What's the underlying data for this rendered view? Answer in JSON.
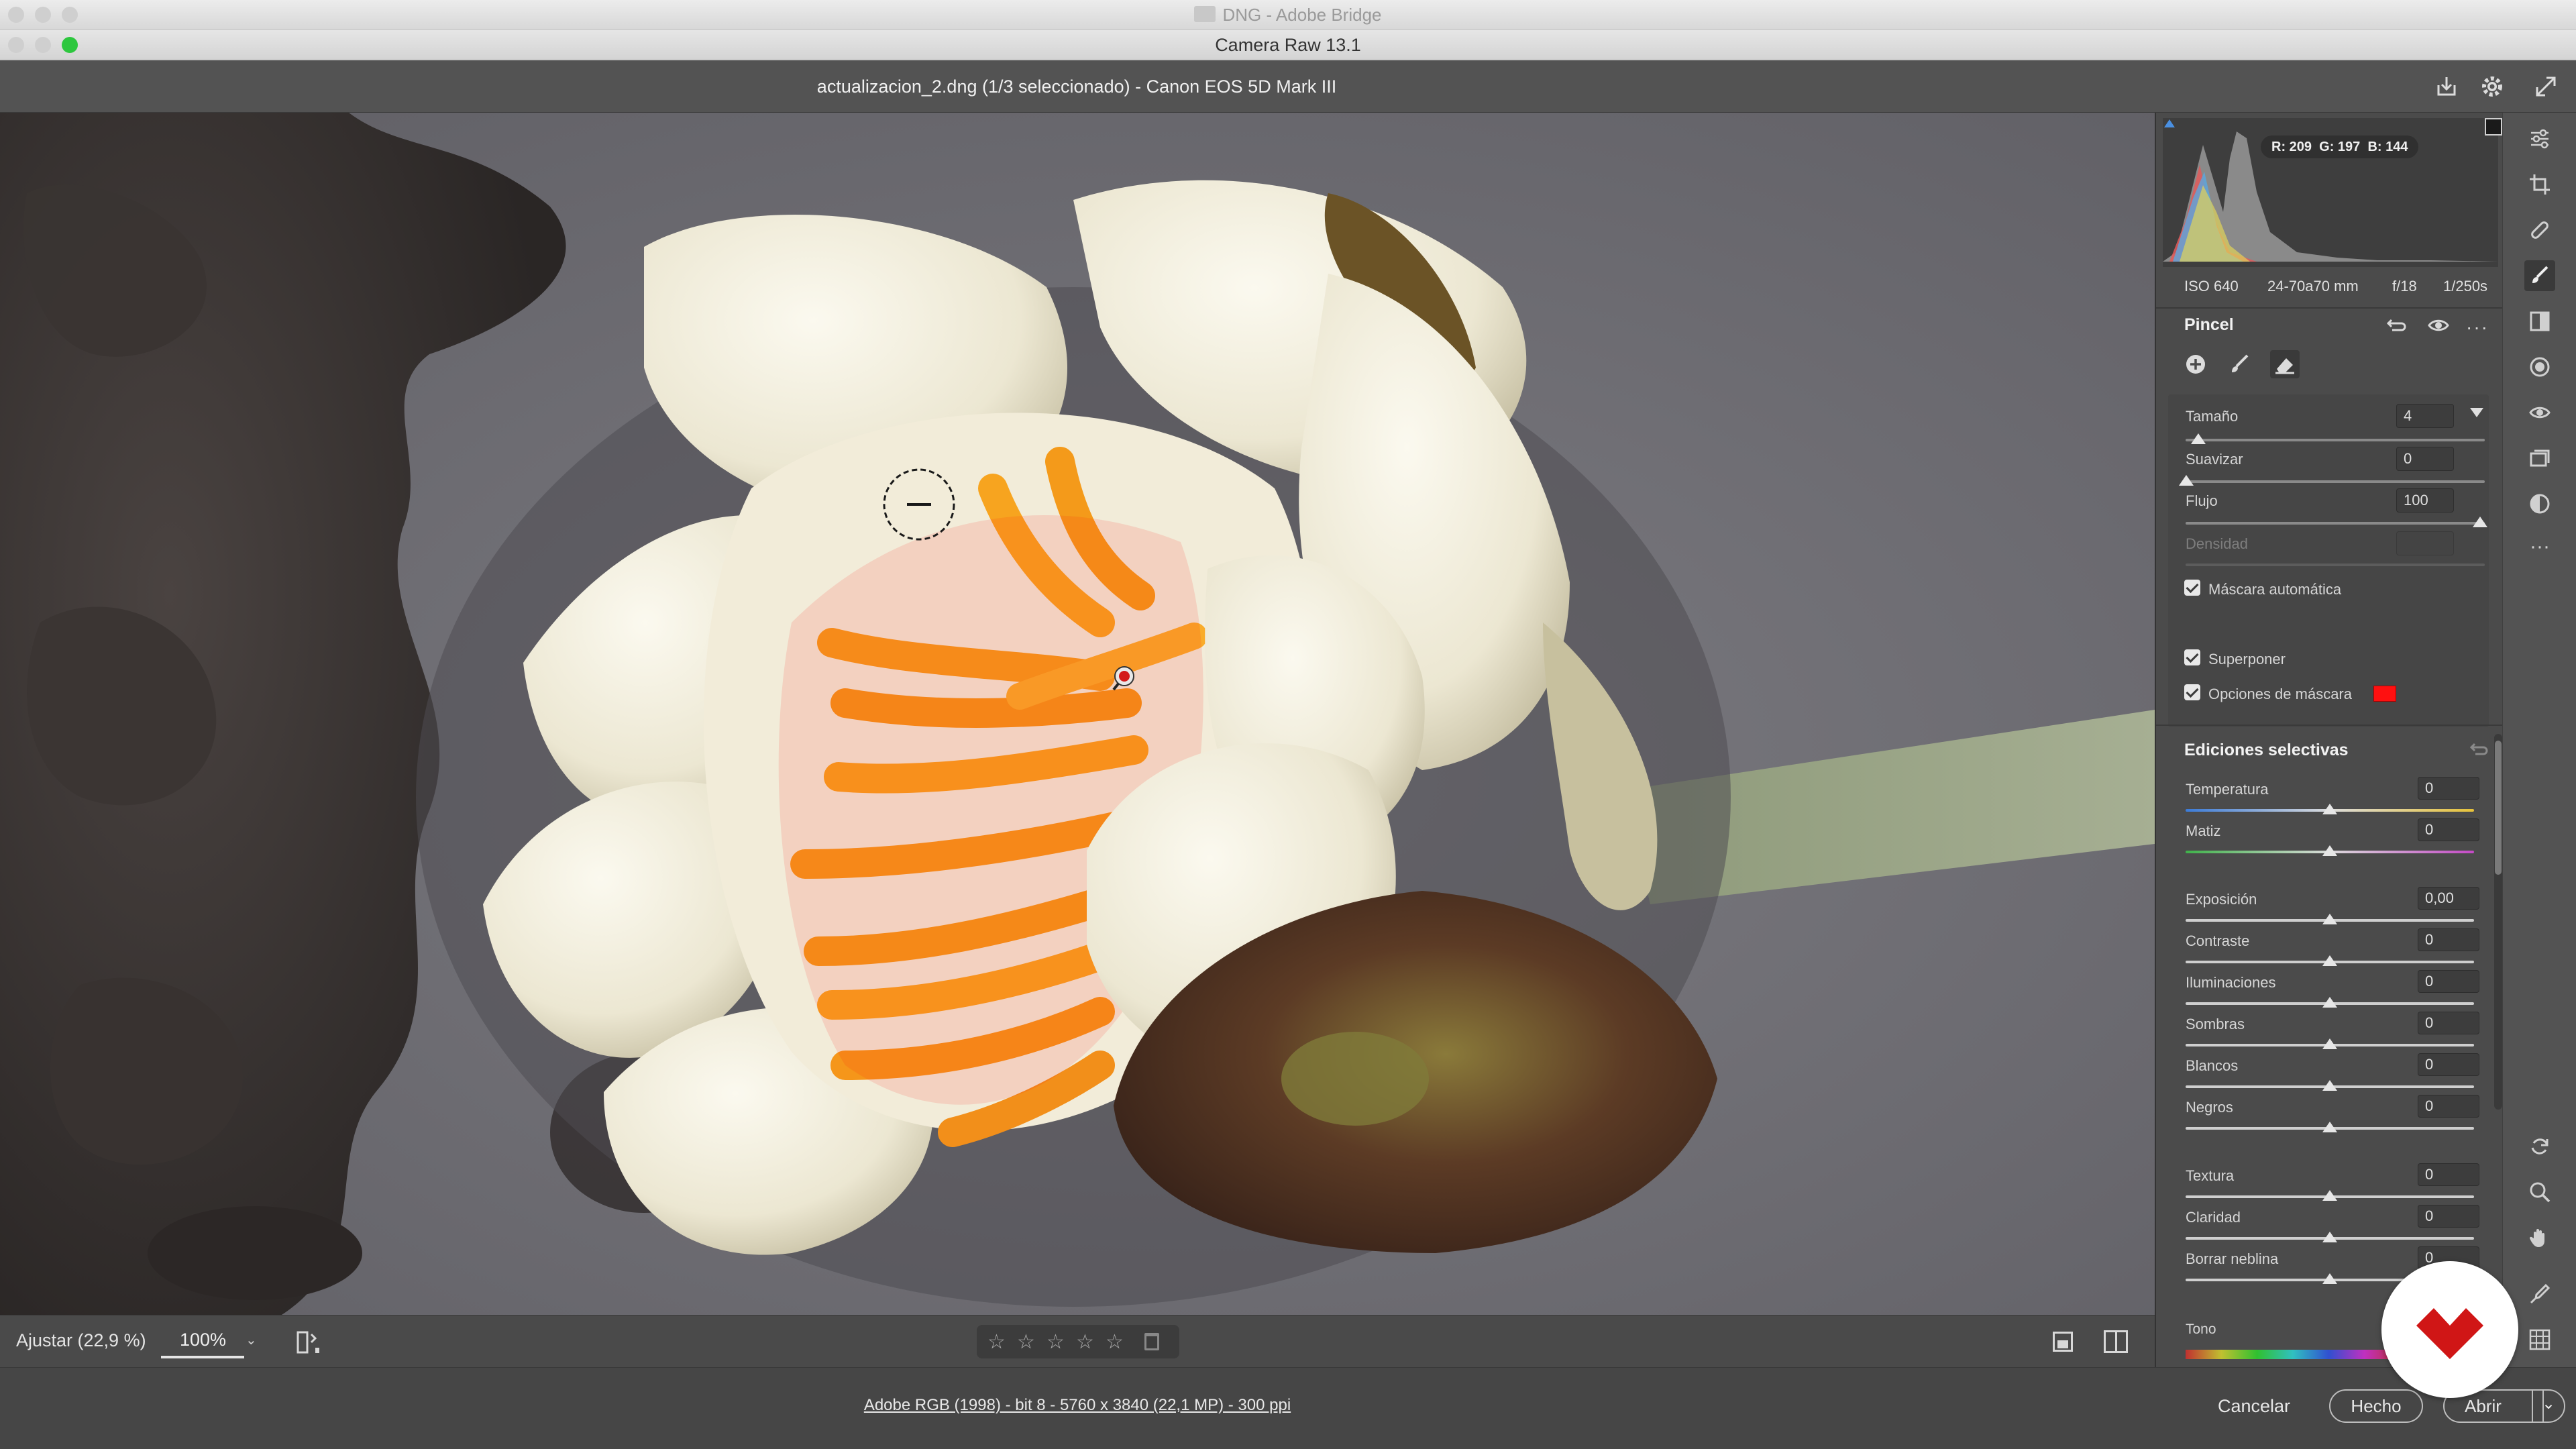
{
  "os": {
    "back_window_title": "DNG - Adobe Bridge",
    "window_title": "Camera Raw 13.1"
  },
  "header": {
    "document_title": "actualizacion_2.dng (1/3 seleccionado) -  Canon EOS 5D Mark III"
  },
  "histogram": {
    "rgb_readout": {
      "r": "R: 209",
      "g": "G: 197",
      "b": "B: 144"
    },
    "exif": {
      "iso": "ISO 640",
      "lens": "24-70a70 mm",
      "aperture": "f/18",
      "shutter": "1/250s"
    }
  },
  "brush": {
    "title": "Pincel",
    "size": {
      "label": "Tamaño",
      "value": "4",
      "level_percent": 4
    },
    "feather": {
      "label": "Suavizar",
      "value": "0",
      "level_percent": 0
    },
    "flow": {
      "label": "Flujo",
      "value": "100",
      "level_percent": 100
    },
    "density": {
      "label": "Densidad",
      "value": ""
    },
    "auto_mask": {
      "label": "Máscara automática",
      "checked": true
    },
    "overlay": {
      "label": "Superponer",
      "checked": true
    },
    "mask_options": {
      "label": "Opciones de máscara",
      "checked": true,
      "swatch_color": "#ff1010"
    }
  },
  "selective": {
    "title": "Ediciones selectivas",
    "sliders": [
      {
        "label": "Temperatura",
        "value": "0"
      },
      {
        "label": "Matiz",
        "value": "0"
      },
      {
        "label": "Exposición",
        "value": "0,00"
      },
      {
        "label": "Contraste",
        "value": "0"
      },
      {
        "label": "Iluminaciones",
        "value": "0"
      },
      {
        "label": "Sombras",
        "value": "0"
      },
      {
        "label": "Blancos",
        "value": "0"
      },
      {
        "label": "Negros",
        "value": "0"
      },
      {
        "label": "Textura",
        "value": "0"
      },
      {
        "label": "Claridad",
        "value": "0"
      },
      {
        "label": "Borrar neblina",
        "value": "0"
      }
    ],
    "tone_label": "Tono"
  },
  "viewbar": {
    "fit_label": "Ajustar (22,9 %)",
    "zoom_value": "100%"
  },
  "footer": {
    "file_info": "Adobe RGB (1998) - bit 8 - 5760 x 3840 (22,1 MP) - 300 ppi",
    "cancel_label": "Cancelar",
    "done_label": "Hecho",
    "open_label": "Abrir"
  },
  "colors": {
    "panel_bg": "#4b4b4b",
    "mask_overlay": "#ff1010"
  }
}
